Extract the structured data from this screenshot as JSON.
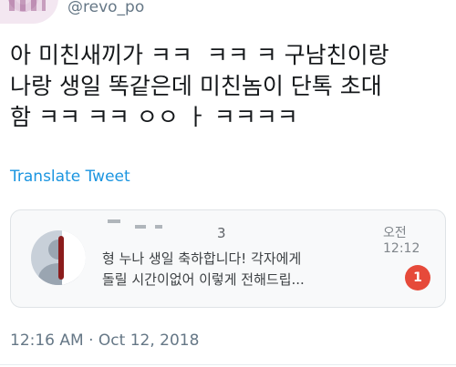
{
  "tweet": {
    "handle": "@revo_po",
    "text": "아 미친새끼가 ㅋㅋ  ㅋㅋ ㅋ 구남친이랑\n나랑 생일 똑같은데 미친놈이 단톡 초대\n함 ㅋㅋ ㅋㅋ ㅇㅇ ㅏ ㅋㅋㅋㅋ",
    "translate_label": "Translate Tweet",
    "timestamp": "12:16 AM · Oct 12, 2018"
  },
  "notification_card": {
    "sender_suffix": "3",
    "time": "오전 12:12",
    "message": "형 누나 생일 축하합니다! 각자에게\n돌릴 시간이없어 이렇게 전해드립...",
    "unread_count": "1"
  },
  "colors": {
    "link": "#1b95e0",
    "badge": "#e64a3a",
    "muted": "#657786"
  }
}
